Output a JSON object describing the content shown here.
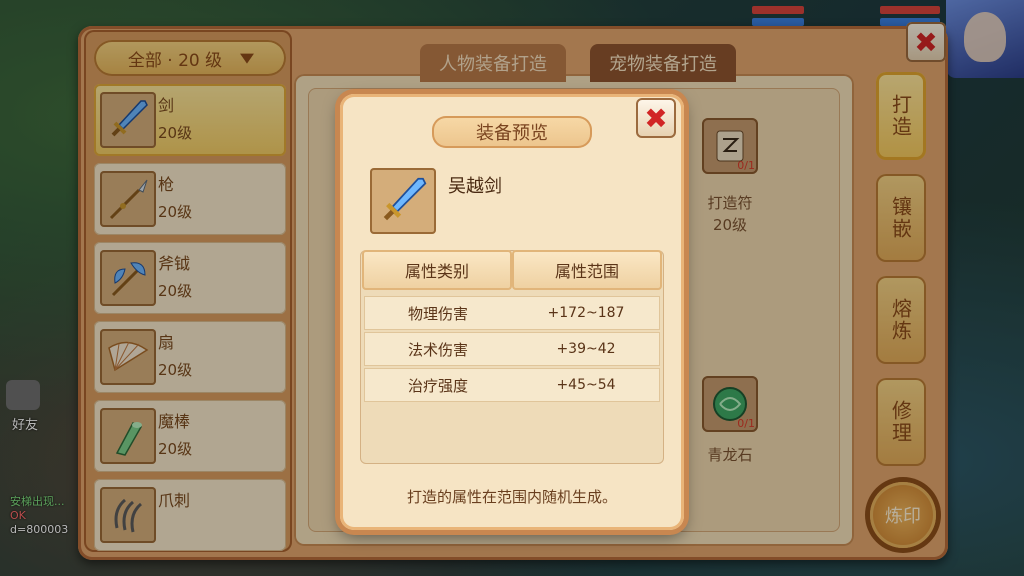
{
  "filter": {
    "label": "全部 · 20 级"
  },
  "tabs": [
    {
      "label": "人物装备打造"
    },
    {
      "label": "宠物装备打造"
    }
  ],
  "weapons": [
    {
      "name": "剑",
      "level": "20级",
      "icon": "sword-icon"
    },
    {
      "name": "枪",
      "level": "20级",
      "icon": "spear-icon"
    },
    {
      "name": "斧钺",
      "level": "20级",
      "icon": "axe-icon"
    },
    {
      "name": "扇",
      "level": "20级",
      "icon": "fan-icon"
    },
    {
      "name": "魔棒",
      "level": "20级",
      "icon": "wand-icon"
    },
    {
      "name": "爪刺",
      "level": "",
      "icon": "claw-icon"
    }
  ],
  "materials": [
    {
      "name": "打造符",
      "level": "20级",
      "count": "0/1",
      "icon": "forge-talisman-icon"
    },
    {
      "name": "青龙石",
      "count": "0/1",
      "icon": "azure-dragon-stone-icon"
    }
  ],
  "side_tabs": [
    {
      "label": "打造"
    },
    {
      "label": "镶嵌"
    },
    {
      "label": "熔炼"
    },
    {
      "label": "修理"
    }
  ],
  "refine_button": "炼印",
  "left_hud": {
    "friend": "好友",
    "log": [
      "安梯出现...",
      "OK",
      "d=800003"
    ]
  },
  "dialog": {
    "title": "装备预览",
    "item_name": "吴越剑",
    "headers": [
      "属性类别",
      "属性范围"
    ],
    "rows": [
      {
        "stat": "物理伤害",
        "range": "+172~187"
      },
      {
        "stat": "法术伤害",
        "range": "+39~42"
      },
      {
        "stat": "治疗强度",
        "range": "+45~54"
      }
    ],
    "note": "打造的属性在范围内随机生成。"
  },
  "colors": {
    "frame": "#e2a66c",
    "accent_gold": "#f2cc64",
    "close_red": "#d12525"
  }
}
